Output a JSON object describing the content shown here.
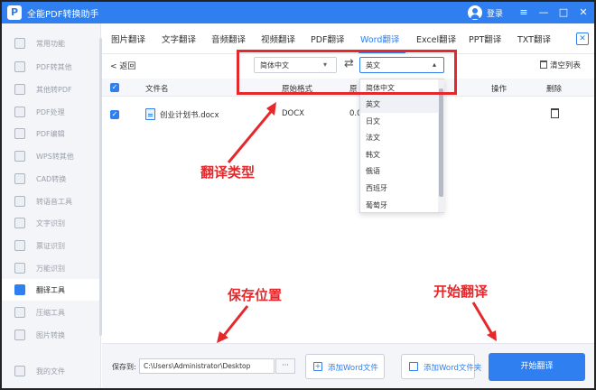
{
  "app": {
    "title": "全能PDF转换助手",
    "login": "登录"
  },
  "window_controls": {
    "menu": "≡",
    "minimize": "—",
    "maximize": "□",
    "close": "✕"
  },
  "sidebar": {
    "items": [
      {
        "label": "常用功能",
        "icon": "star-icon"
      },
      {
        "label": "PDF转其他",
        "icon": "pdf-icon"
      },
      {
        "label": "其他转PDF",
        "icon": "convert-icon"
      },
      {
        "label": "PDF处理",
        "icon": "tools-icon"
      },
      {
        "label": "PDF编辑",
        "icon": "edit-icon"
      },
      {
        "label": "WPS转其他",
        "icon": "wps-icon"
      },
      {
        "label": "CAD转换",
        "icon": "cad-icon"
      },
      {
        "label": "转语音工具",
        "icon": "audio-icon"
      },
      {
        "label": "文字识别",
        "icon": "ocr-icon"
      },
      {
        "label": "票证识别",
        "icon": "ticket-icon"
      },
      {
        "label": "万能识别",
        "icon": "scan-icon"
      },
      {
        "label": "翻译工具",
        "icon": "translate-icon",
        "active": true
      },
      {
        "label": "压缩工具",
        "icon": "compress-icon"
      },
      {
        "label": "图片转换",
        "icon": "image-icon"
      },
      {
        "label": "我的文件",
        "icon": "folder-icon"
      }
    ]
  },
  "tabs": [
    "图片翻译",
    "文字翻译",
    "音频翻译",
    "视频翻译",
    "PDF翻译",
    "Word翻译",
    "Excel翻译",
    "PPT翻译",
    "TXT翻译"
  ],
  "active_tab": "Word翻译",
  "toolbar": {
    "back": "< 返回",
    "source_lang": "简体中文",
    "target_lang": "英文",
    "clear_list": "清空列表"
  },
  "table": {
    "headers": {
      "filename": "文件名",
      "format": "原始格式",
      "pages": "原",
      "action": "操作",
      "delete": "删除"
    },
    "rows": [
      {
        "filename": "创业计划书.docx",
        "format": "DOCX",
        "pages": "0.0"
      }
    ]
  },
  "dropdown": {
    "options": [
      "简体中文",
      "英文",
      "日文",
      "法文",
      "韩文",
      "俄语",
      "西班牙",
      "葡萄牙"
    ],
    "selected": "英文"
  },
  "annotations": {
    "translate_type": "翻译类型",
    "save_location": "保存位置",
    "start_translation": "开始翻译"
  },
  "bottom": {
    "save_label": "保存到:",
    "save_path": "C:\\Users\\Administrator\\Desktop",
    "browse": "···",
    "add_file": "添加Word文件",
    "add_folder": "添加Word文件夹",
    "start": "开始翻译"
  },
  "colors": {
    "accent": "#2f7ff0",
    "annotation": "#e4282b"
  }
}
